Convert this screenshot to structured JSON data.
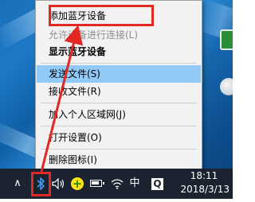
{
  "context_menu": {
    "items": [
      {
        "label": "添加蓝牙设备"
      },
      {
        "label": "允许设备进行连接(L)"
      },
      {
        "label": "显示蓝牙设备"
      },
      {
        "label": "发送文件(S)"
      },
      {
        "label": "接收文件(R)"
      },
      {
        "label": "加入个人区域网(J)"
      },
      {
        "label": "打开设置(O)"
      },
      {
        "label": "删除图标(I)"
      }
    ],
    "highlighted_item": "发送文件(S)"
  },
  "taskbar": {
    "tray_icons": [
      "chevron-up-icon",
      "bluetooth-icon",
      "volume-icon",
      "plus-circle-icon",
      "battery-icon",
      "wifi-icon",
      "ime-icon",
      "q-app-icon"
    ],
    "ime_label": "中",
    "q_label": "Q",
    "time": "18:11",
    "date": "2018/3/13"
  },
  "annotation": {
    "color": "#e32722"
  },
  "colors": {
    "menu_bg": "#f2f2f2",
    "hover_bg": "#91c9f7",
    "taskbar_bg": "#1c2330",
    "bluetooth_blue": "#3d9bf0"
  }
}
